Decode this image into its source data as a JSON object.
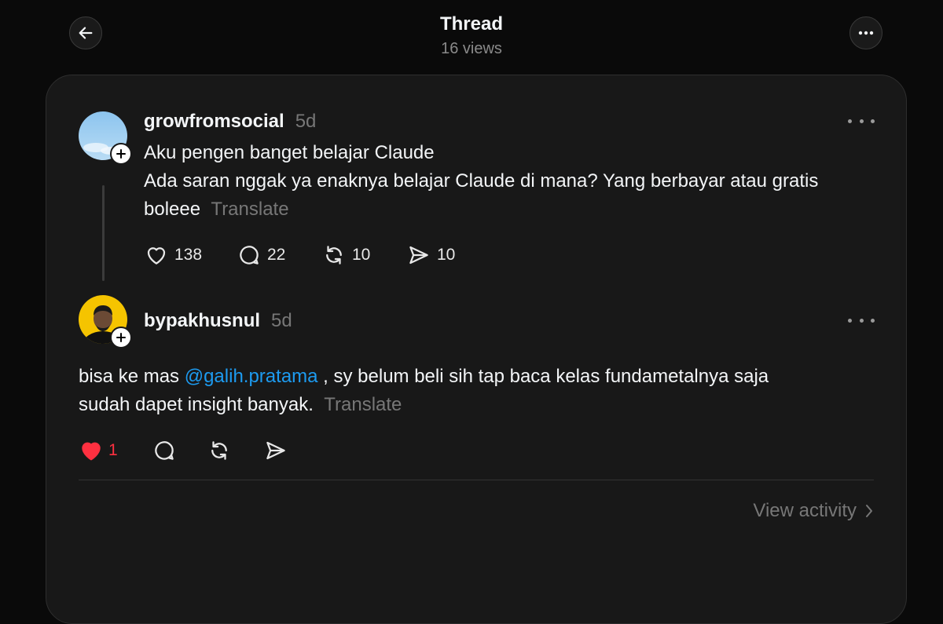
{
  "header": {
    "title": "Thread",
    "views": "16 views",
    "back_icon": "arrow-left-icon",
    "menu_icon": "more-horizontal-icon"
  },
  "post": {
    "username": "growfromsocial",
    "time": "5d",
    "line1": "Aku pengen banget belajar Claude",
    "line2": "Ada saran nggak ya enaknya belajar Claude di mana? Yang berbayar atau gratis",
    "line3": "boleee",
    "translate": "Translate",
    "likes": "138",
    "comments": "22",
    "reposts": "10",
    "shares": "10"
  },
  "reply": {
    "username": "bypakhusnul",
    "time": "5d",
    "text_before": "bisa ke mas ",
    "mention": "@galih.pratama",
    "text_after": " , sy belum beli sih tap baca kelas fundametalnya saja",
    "line2": "sudah dapet insight banyak.",
    "translate": "Translate",
    "likes": "1",
    "liked": true
  },
  "footer": {
    "view_activity": "View activity"
  },
  "colors": {
    "background": "#0a0a0a",
    "card": "#181818",
    "mention": "#1d9bf0",
    "like_active": "#ff3040",
    "muted": "#777777"
  }
}
